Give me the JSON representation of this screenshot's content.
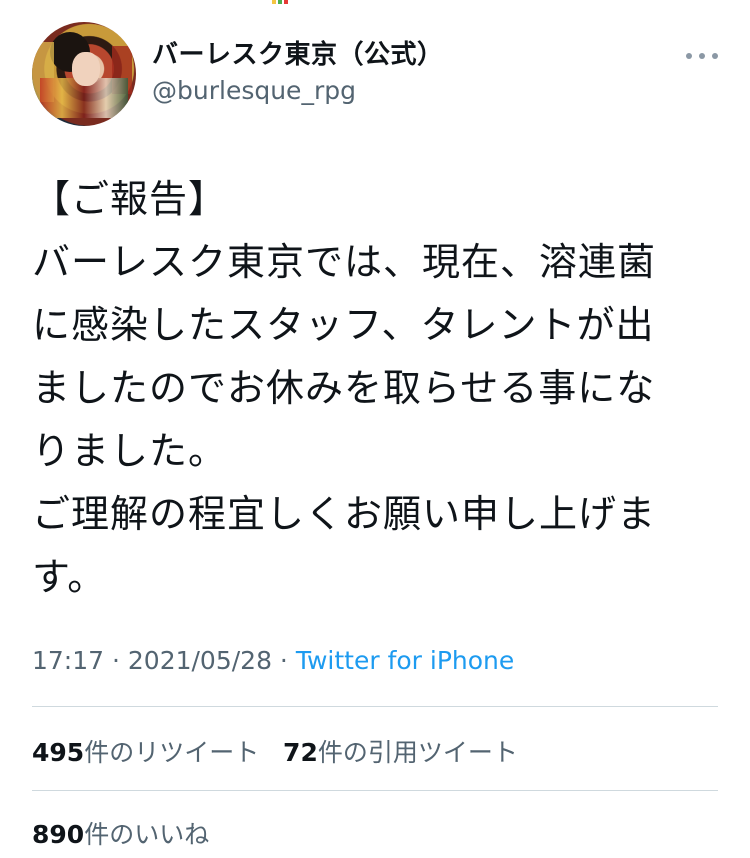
{
  "tweet": {
    "display_name": "バーレスク東京（公式）",
    "handle": "@burlesque_rpg",
    "text": "【ご報告】\nバーレスク東京では、現在、溶連菌\nに感染したスタッフ、タレントが出\nましたのでお休みを取らせる事にな\nりました。\nご理解の程宜しくお願い申し上げま\nす。",
    "time": "17:17",
    "date": "2021/05/28",
    "separator": " · ",
    "source": "Twitter for iPhone"
  },
  "stats": {
    "retweets_count": "495",
    "retweets_label": "件のリツイート",
    "quotes_count": "72",
    "quotes_label": "件の引用ツイート",
    "likes_count": "890",
    "likes_label": "件のいいね"
  },
  "icons": {
    "more": "more-horizontal-icon",
    "avatar": "profile-avatar"
  },
  "colors": {
    "text_primary": "#0f1419",
    "text_secondary": "#536471",
    "link": "#1d9bf0",
    "divider": "#cfd9de"
  }
}
